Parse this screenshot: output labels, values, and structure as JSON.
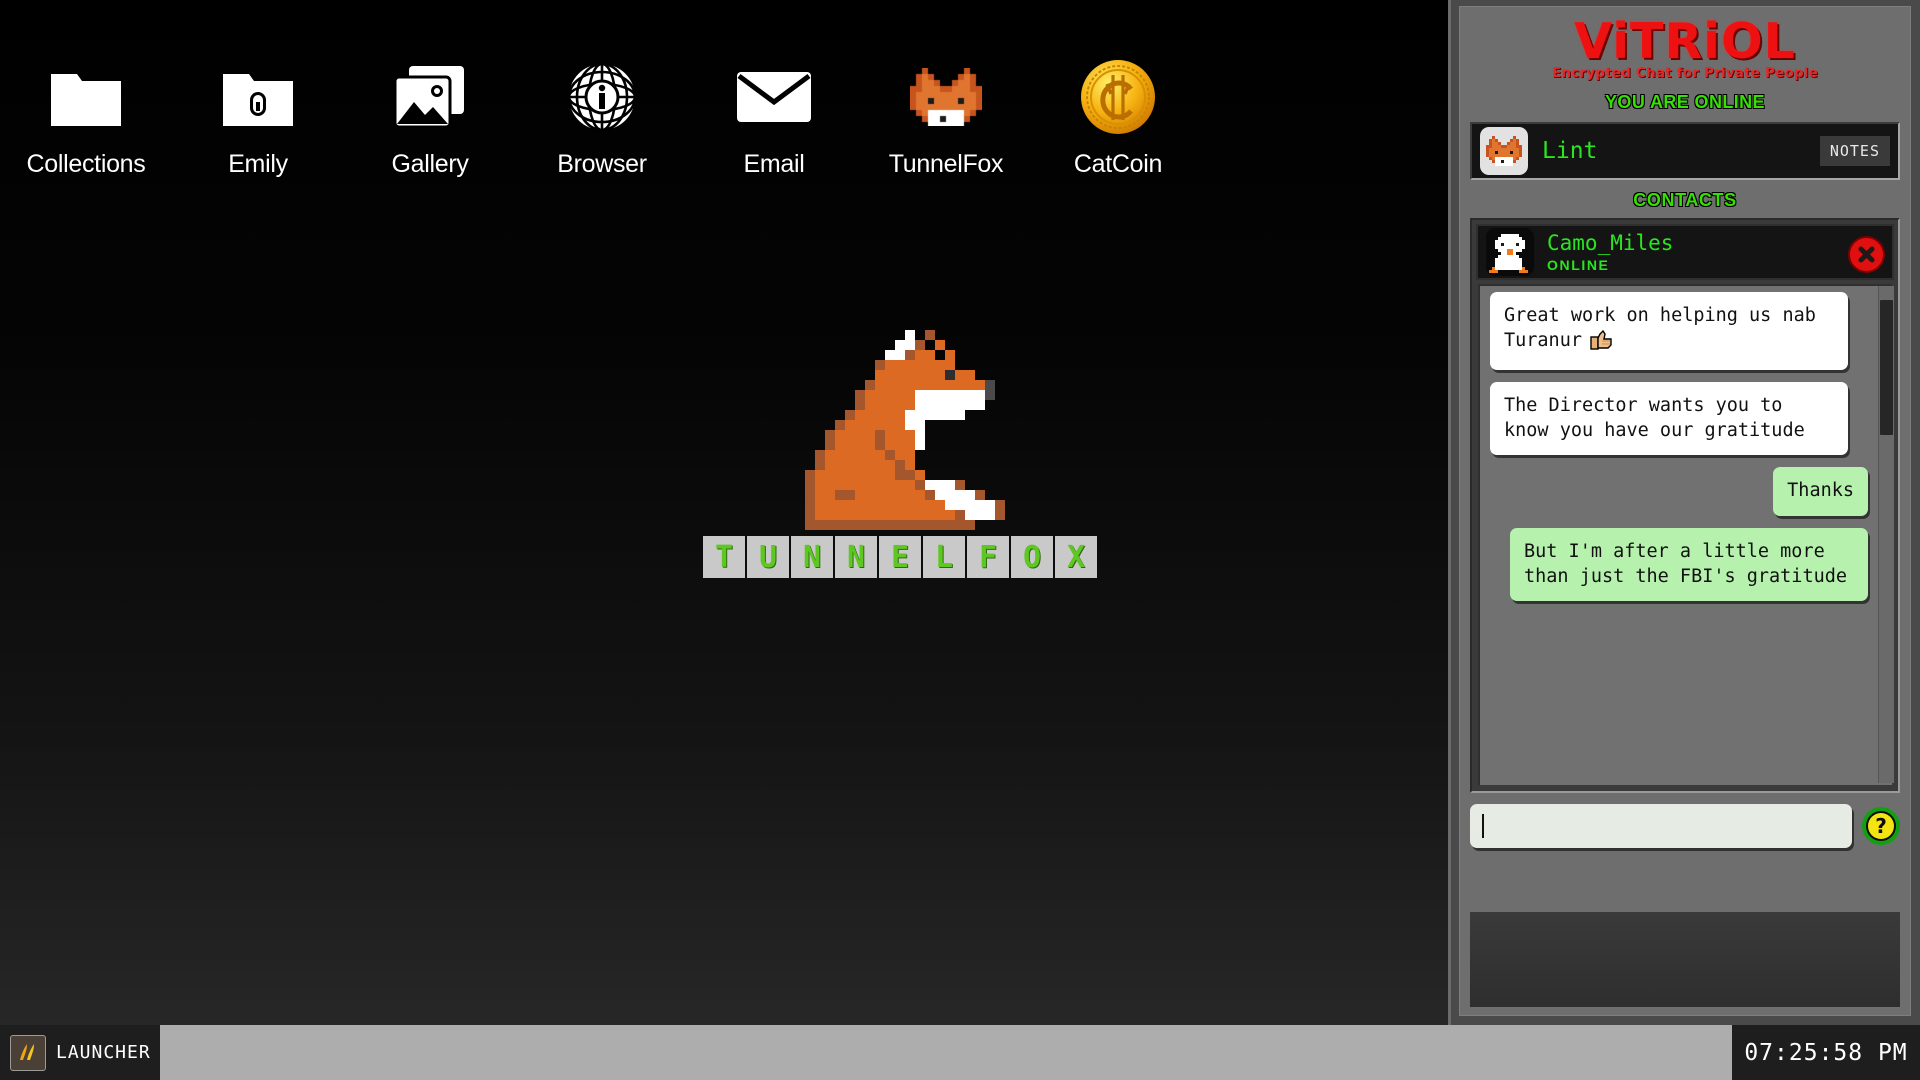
{
  "desktop": {
    "icons": [
      {
        "label": "Collections",
        "icon": "folder-icon"
      },
      {
        "label": "Emily",
        "icon": "locked-folder-icon"
      },
      {
        "label": "Gallery",
        "icon": "photos-icon"
      },
      {
        "label": "Browser",
        "icon": "globe-info-icon"
      },
      {
        "label": "Email",
        "icon": "envelope-icon"
      },
      {
        "label": "TunnelFox",
        "icon": "fox-head-icon"
      },
      {
        "label": "CatCoin",
        "icon": "gold-coin-icon"
      }
    ],
    "wallpaper": {
      "art": "pixel-fox",
      "wordmark": [
        "T",
        "U",
        "N",
        "N",
        "E",
        "L",
        "F",
        "O",
        "X"
      ],
      "wordmark_text_color": "#5fc724",
      "wordmark_tile_color": "#c9c9c9"
    }
  },
  "chat_app": {
    "logo": "ViTRiOL",
    "logo_color": "#ee1111",
    "tagline": "Encrypted Chat for Private People",
    "status_banner": "YOU ARE ONLINE",
    "status_color": "#36e002",
    "me": {
      "name": "Lint",
      "avatar": "fox-avatar",
      "notes_label": "NOTES"
    },
    "contacts_header": "CONTACTS",
    "active_contact": {
      "name": "Camo_Miles",
      "status": "ONLINE",
      "avatar": "penguin-avatar",
      "close_label": "close"
    },
    "messages": [
      {
        "from": "them",
        "text": "Great work on helping us nab Turanur",
        "emoji": "thumbs-up"
      },
      {
        "from": "them",
        "text": "The Director wants you to know you have our gratitude"
      },
      {
        "from": "me",
        "text": "Thanks",
        "short": true
      },
      {
        "from": "me",
        "text": "But I'm after a little more than just the FBI's gratitude"
      }
    ],
    "composer": {
      "value": "",
      "placeholder": "",
      "help_label": "?"
    }
  },
  "taskbar": {
    "launcher_label": "LAUNCHER",
    "launcher_icon": "launcher-flame-icon",
    "clock": "07:25:58 PM"
  }
}
